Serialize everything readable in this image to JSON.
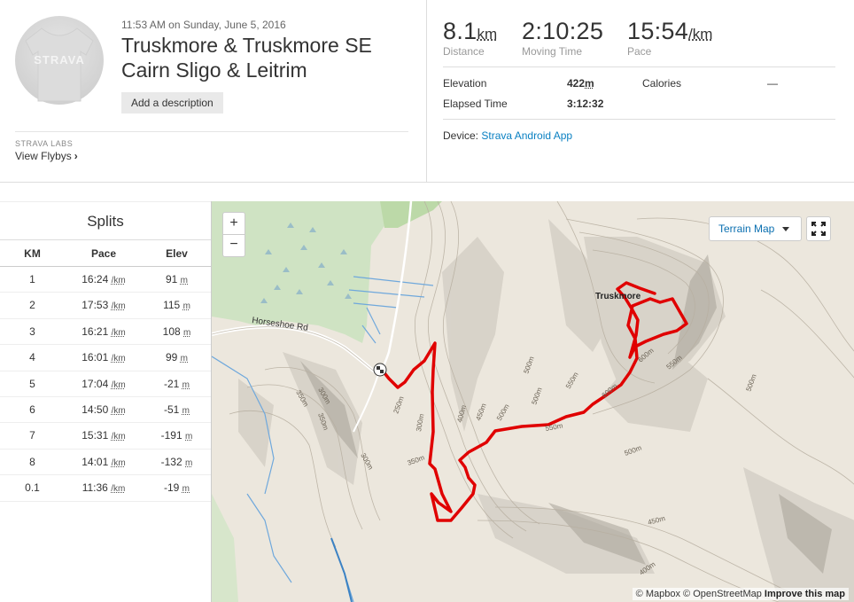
{
  "header": {
    "avatar_logo": "STRAVA",
    "date": "11:53 AM on Sunday, June 5, 2016",
    "title": "Truskmore & Truskmore SE Cairn Sligo & Leitrim",
    "add_description": "Add a description",
    "labs_label": "STRAVA LABS",
    "flyby_link": "View Flybys"
  },
  "stats": {
    "distance": {
      "value": "8.1",
      "unit": "km",
      "label": "Distance"
    },
    "moving_time": {
      "value": "2:10:25",
      "label": "Moving Time"
    },
    "pace": {
      "value": "15:54",
      "unit": "/km",
      "label": "Pace"
    },
    "elevation_label": "Elevation",
    "elevation_value": "422",
    "elevation_unit": "m",
    "calories_label": "Calories",
    "calories_value": "—",
    "elapsed_label": "Elapsed Time",
    "elapsed_value": "3:12:32",
    "device_label": "Device:",
    "device_value": "Strava Android App"
  },
  "splits": {
    "title": "Splits",
    "columns": [
      "KM",
      "Pace",
      "Elev"
    ],
    "pace_unit": "/km",
    "elev_unit": "m",
    "rows": [
      {
        "km": "1",
        "pace": "16:24",
        "elev": "91"
      },
      {
        "km": "2",
        "pace": "17:53",
        "elev": "115"
      },
      {
        "km": "3",
        "pace": "16:21",
        "elev": "108"
      },
      {
        "km": "4",
        "pace": "16:01",
        "elev": "99"
      },
      {
        "km": "5",
        "pace": "17:04",
        "elev": "-21"
      },
      {
        "km": "6",
        "pace": "14:50",
        "elev": "-51"
      },
      {
        "km": "7",
        "pace": "15:31",
        "elev": "-191"
      },
      {
        "km": "8",
        "pace": "14:01",
        "elev": "-132"
      },
      {
        "km": "0.1",
        "pace": "11:36",
        "elev": "-19"
      }
    ]
  },
  "map": {
    "zoom_in": "+",
    "zoom_out": "−",
    "terrain_button": "Terrain Map",
    "road_label": "Horseshoe Rd",
    "peak_label": "Truskmore",
    "contour_labels": [
      "350m",
      "300m",
      "350m",
      "300m",
      "250m",
      "300m",
      "350m",
      "400m",
      "450m",
      "500m",
      "500m",
      "550m",
      "550m",
      "500m",
      "600m",
      "550m",
      "600m",
      "500m",
      "500m",
      "450m",
      "400m"
    ],
    "attribution_mapbox": "© Mapbox",
    "attribution_osm": "© OpenStreetMap",
    "attribution_improve": "Improve this map",
    "route_color": "#e00000"
  }
}
